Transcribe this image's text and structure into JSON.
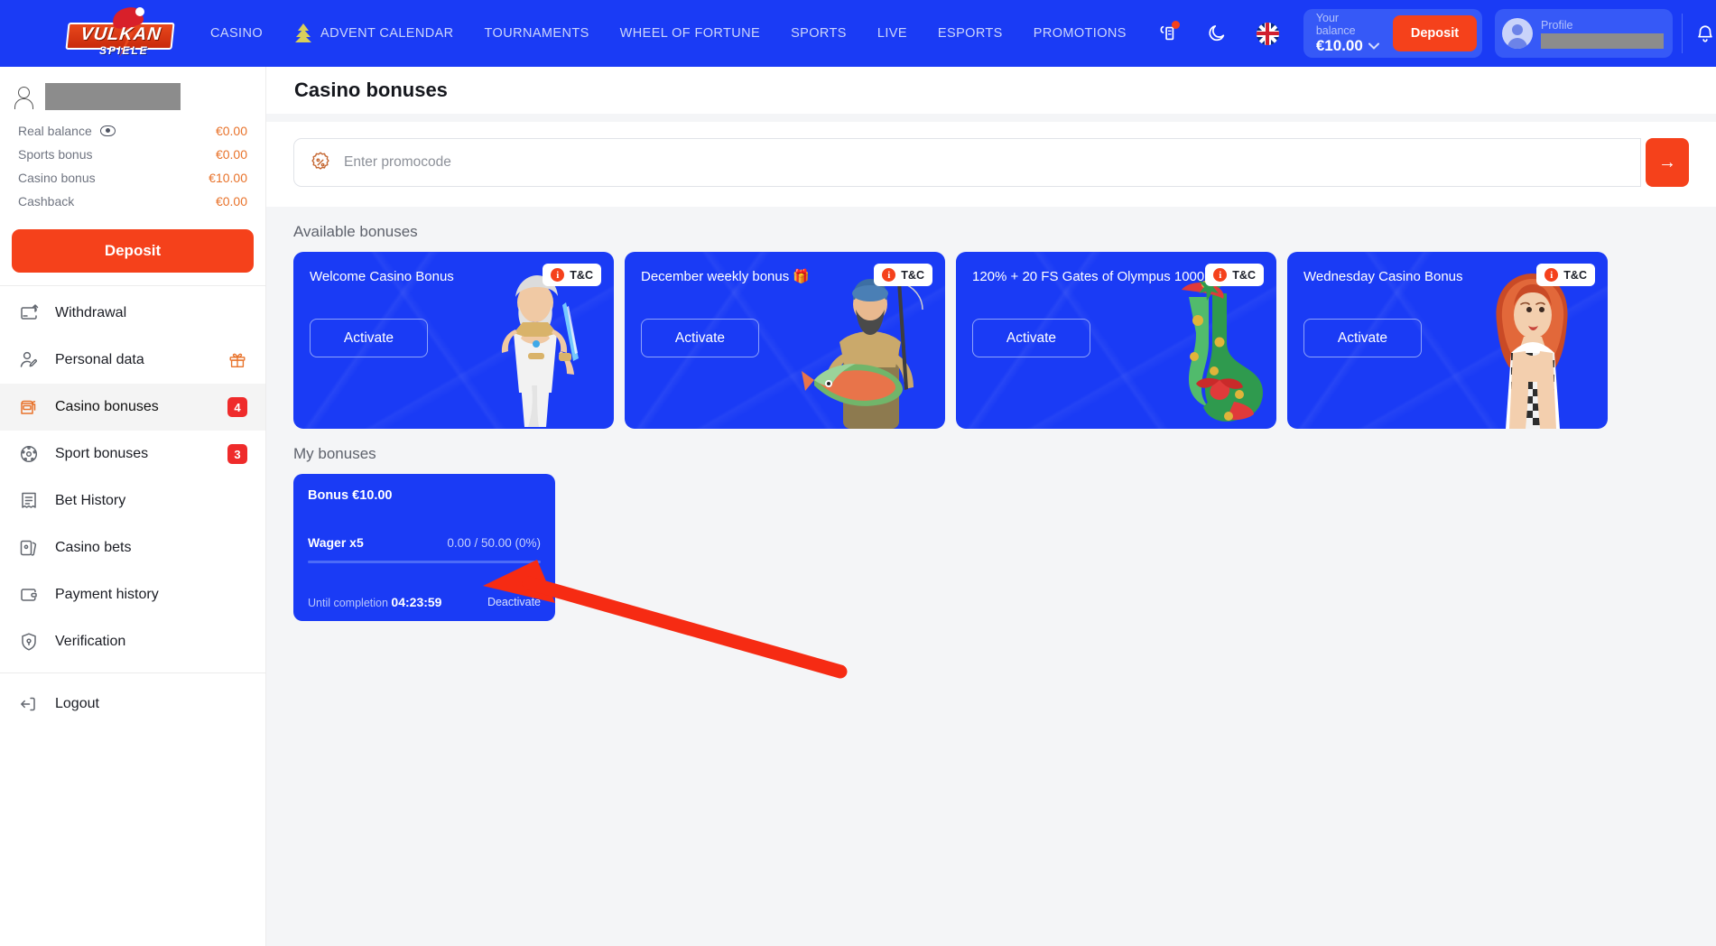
{
  "header": {
    "logo": {
      "main": "VULKAN",
      "sub": "SPIELE"
    },
    "nav": [
      {
        "label": "CASINO",
        "icon": null
      },
      {
        "label": "ADVENT CALENDAR",
        "icon": "christmas-tree-icon"
      },
      {
        "label": "TOURNAMENTS",
        "icon": null
      },
      {
        "label": "WHEEL OF FORTUNE",
        "icon": null
      },
      {
        "label": "SPORTS",
        "icon": null
      },
      {
        "label": "LIVE",
        "icon": null
      },
      {
        "label": "ESPORTS",
        "icon": null
      },
      {
        "label": "PROMOTIONS",
        "icon": null
      }
    ],
    "icons": {
      "accessibility": "accessibility-icon",
      "dark_mode": "moon-icon",
      "language": "uk-flag-icon",
      "notifications": "bell-icon"
    },
    "balance": {
      "label": "Your balance",
      "amount": "€10.00",
      "chevron": "⌄"
    },
    "deposit_label": "Deposit",
    "profile": {
      "label": "Profile",
      "name_redacted": ""
    }
  },
  "sidebar": {
    "user": {
      "name_redacted": ""
    },
    "balances": [
      {
        "label": "Real balance",
        "value": "€0.00",
        "has_eye": true
      },
      {
        "label": "Sports bonus",
        "value": "€0.00",
        "has_eye": false
      },
      {
        "label": "Casino bonus",
        "value": "€10.00",
        "has_eye": false
      },
      {
        "label": "Cashback",
        "value": "€0.00",
        "has_eye": false
      }
    ],
    "deposit_label": "Deposit",
    "menu": [
      {
        "label": "Withdrawal",
        "icon": "withdrawal-icon",
        "badge": null,
        "gift": false,
        "active": false
      },
      {
        "label": "Personal data",
        "icon": "user-edit-icon",
        "badge": null,
        "gift": true,
        "active": false
      },
      {
        "label": "Casino bonuses",
        "icon": "slot-machine-icon",
        "badge": "4",
        "gift": false,
        "active": true
      },
      {
        "label": "Sport bonuses",
        "icon": "ball-icon",
        "badge": "3",
        "gift": false,
        "active": false
      },
      {
        "label": "Bet History",
        "icon": "receipt-icon",
        "badge": null,
        "gift": false,
        "active": false
      },
      {
        "label": "Casino bets",
        "icon": "cards-icon",
        "badge": null,
        "gift": false,
        "active": false
      },
      {
        "label": "Payment history",
        "icon": "wallet-icon",
        "badge": null,
        "gift": false,
        "active": false
      },
      {
        "label": "Verification",
        "icon": "shield-check-icon",
        "badge": null,
        "gift": false,
        "active": false
      }
    ],
    "logout": {
      "label": "Logout",
      "icon": "logout-icon"
    }
  },
  "main": {
    "page_title": "Casino bonuses",
    "promocode": {
      "placeholder": "Enter promocode",
      "value": "",
      "icon": "percent-badge-icon",
      "submit_icon": "→"
    },
    "available_section_title": "Available bonuses",
    "available_bonuses": [
      {
        "title": "Welcome Casino Bonus",
        "activate_label": "Activate",
        "tc_label": "T&C",
        "art": "zeus"
      },
      {
        "title": "December weekly bonus 🎁",
        "activate_label": "Activate",
        "tc_label": "T&C",
        "art": "fisherman"
      },
      {
        "title": "120% + 20 FS Gates of Olympus 1000",
        "activate_label": "Activate",
        "tc_label": "T&C",
        "art": "stocking"
      },
      {
        "title": "Wednesday Casino Bonus",
        "activate_label": "Activate",
        "tc_label": "T&C",
        "art": "woman"
      }
    ],
    "my_section_title": "My bonuses",
    "my_bonuses": [
      {
        "title": "Bonus €10.00",
        "wager_label": "Wager x5",
        "wager_progress": "0.00 / 50.00 (0%)",
        "progress_percent": 0,
        "until_label": "Until completion",
        "timer": "04:23:59",
        "deactivate_label": "Deactivate"
      }
    ]
  },
  "colors": {
    "brand_blue": "#1a3bf5",
    "accent_orange": "#f5411b",
    "badge_red": "#ef2b2b",
    "bonus_value_orange": "#e8722a",
    "page_bg": "#f4f5f7",
    "annotation_red": "#f62b13"
  },
  "annotation": {
    "type": "arrow",
    "color": "#f62b13",
    "points_at": "my-bonus-card"
  }
}
